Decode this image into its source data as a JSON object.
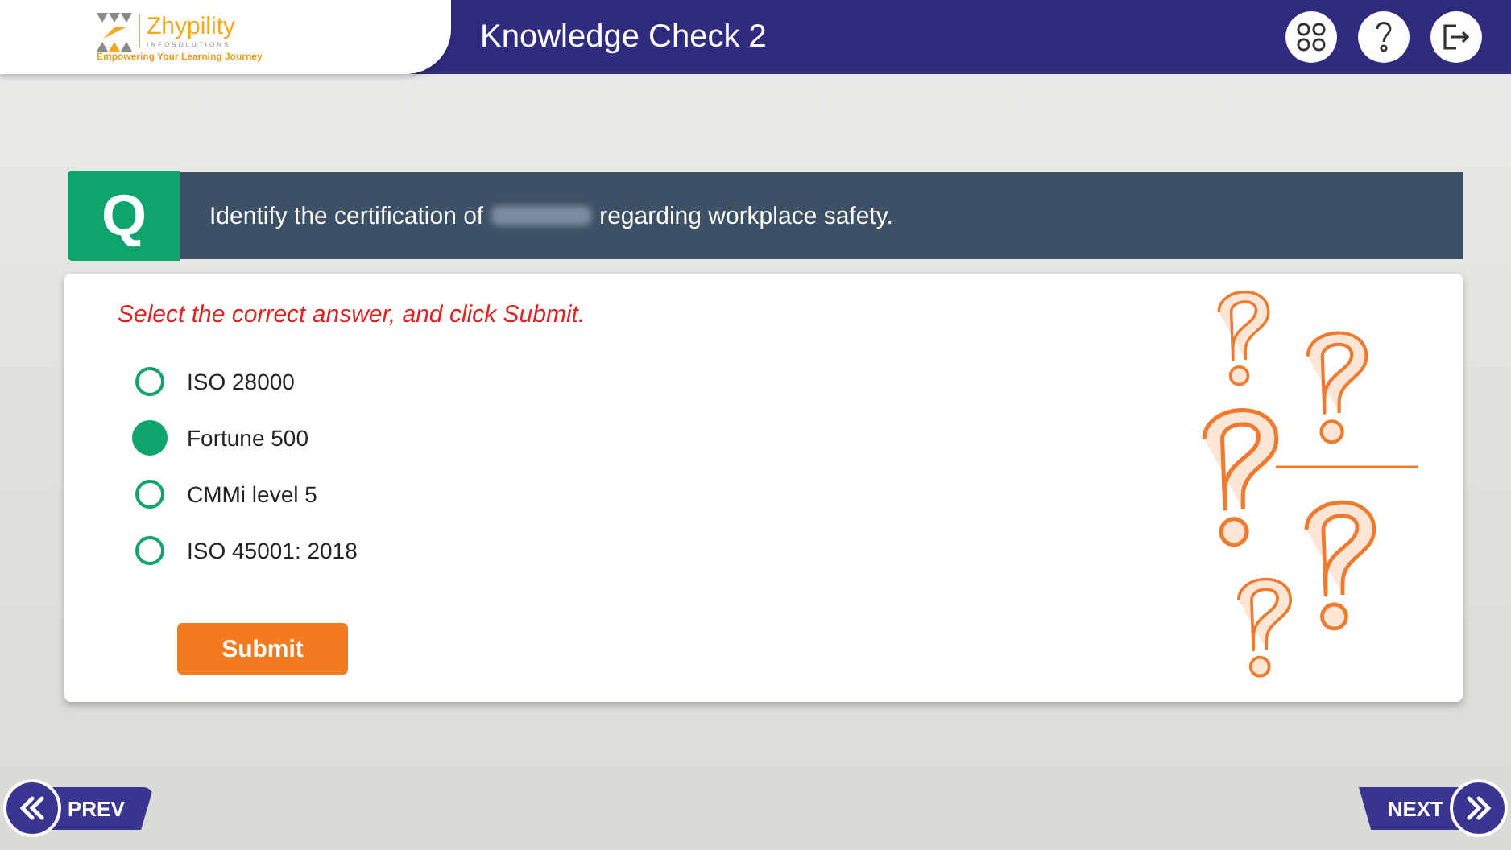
{
  "logo": {
    "name": "Zhypility",
    "subtitle": "INFOSOLUTIONS",
    "tagline": "Empowering Your Learning Journey"
  },
  "header": {
    "title": "Knowledge Check 2"
  },
  "question": {
    "badge": "Q",
    "text_before": "Identify the certification of",
    "text_after": "regarding workplace safety.",
    "redacted": true
  },
  "instruction": "Select the correct answer, and click Submit.",
  "options": [
    {
      "label": "ISO 28000",
      "selected": false
    },
    {
      "label": "Fortune 500",
      "selected": true
    },
    {
      "label": "CMMi level 5",
      "selected": false
    },
    {
      "label": "ISO 45001: 2018",
      "selected": false
    }
  ],
  "submit": "Submit",
  "nav": {
    "prev": "PREV",
    "next": "NEXT"
  }
}
